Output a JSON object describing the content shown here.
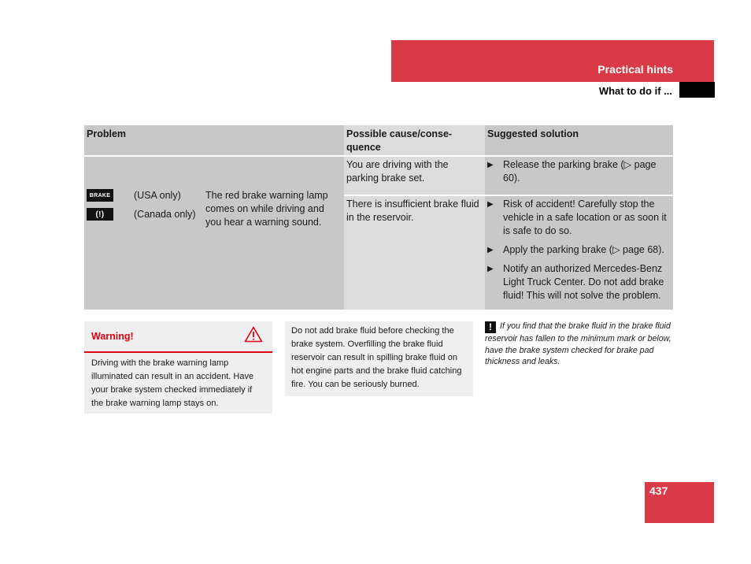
{
  "header": {
    "section_title": "Practical hints",
    "subsection_title": "What to do if ..."
  },
  "table": {
    "columns": [
      "Problem",
      "Possible cause/conse-quence",
      "Suggested solution"
    ],
    "columns_display": {
      "problem": "Problem",
      "cause_line1": "Possible cause/conse-",
      "cause_line2": "quence",
      "solution": "Suggested solution"
    },
    "problem": {
      "lamps": [
        {
          "icon": "brake-lamp-icon",
          "glyph": "BRAKE",
          "label": "(USA only)"
        },
        {
          "icon": "brake-circle-lamp-icon",
          "glyph": "(!)",
          "label": "(Canada only)"
        }
      ],
      "description": "The red brake warning lamp comes on while driving and you hear a warning sound."
    },
    "rows": [
      {
        "cause": "You are driving with the parking brake set.",
        "solutions": [
          "Release the parking brake (▷ page 60)."
        ]
      },
      {
        "cause": "There is insufficient brake fluid in the reservoir.",
        "solutions": [
          "Risk of accident! Carefully stop the vehicle in a safe location or as soon it is safe to do so.",
          "Apply the parking brake (▷ page 68).",
          "Notify an authorized Mercedes-Benz Light Truck Center. Do not add brake fluid! This will not solve the problem."
        ]
      }
    ],
    "bullet_glyph": "▶"
  },
  "warning": {
    "title": "Warning!",
    "icon": "warning-triangle-icon",
    "body": "Driving with the brake warning lamp illuminated can result in an accident. Have your brake system checked immediately if the brake warning lamp stays on."
  },
  "note": {
    "body": "Do not add brake fluid before checking the brake system. Overfilling the brake fluid reservoir can result in spilling brake fluid on hot engine parts and the brake fluid catching fire. You can be seriously burned."
  },
  "info": {
    "icon_glyph": "!",
    "body": "If you find that the brake fluid in the brake fluid reservoir has fallen to the minimum mark or below, have the brake system checked for brake pad thickness and leaks."
  },
  "page_number": "437",
  "colors": {
    "brand_red": "#d93a45",
    "warning_red": "#e3000f"
  }
}
